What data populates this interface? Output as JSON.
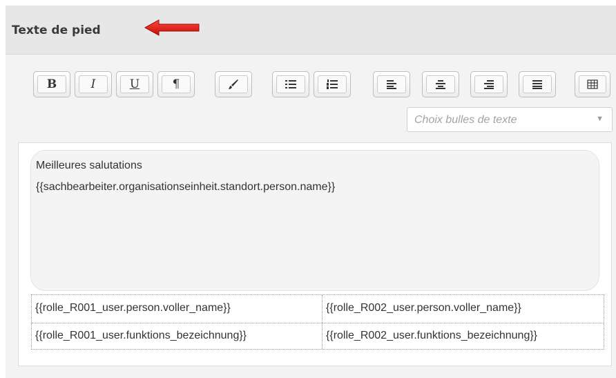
{
  "section": {
    "title": "Texte de pied"
  },
  "toolbar": {
    "bold_label": "B",
    "italic_label": "I",
    "underline_label": "U",
    "paragraph_label": "¶"
  },
  "bubble_select": {
    "placeholder": "Choix bulles de texte"
  },
  "editor": {
    "line1": "Meilleures salutations",
    "line2": "{{sachbearbeiter.organisationseinheit.standort.person.name}}"
  },
  "signature_table": {
    "rows": [
      [
        "{{rolle_R001_user.person.voller_name}}",
        "{{rolle_R002_user.person.voller_name}}"
      ],
      [
        "{{rolle_R001_user.funktions_bezeichnung}}",
        "{{rolle_R002_user.funktions_bezeichnung}}"
      ]
    ]
  },
  "colors": {
    "arrow": "#e0120f",
    "header_bg": "#e7e7e7"
  }
}
